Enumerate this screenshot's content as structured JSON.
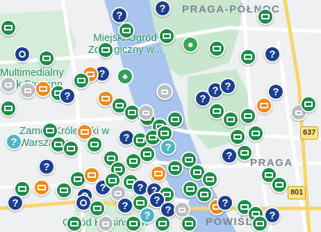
{
  "map": {
    "district_labels": [
      {
        "text": "PRAGA-PÓŁNOC",
        "id": "praga-polnoc"
      },
      {
        "text": "PRAGA",
        "id": "praga"
      },
      {
        "text": "POWIŚLE",
        "id": "powisle"
      }
    ],
    "place_labels": [
      {
        "text": "Miejski Ogród Zoologiczny w...",
        "id": "zoo"
      },
      {
        "text": "Multimedialny Park Fontann",
        "id": "fountain-park"
      },
      {
        "text": "Zamek Królewski w Warszawie",
        "id": "royal-castle"
      },
      {
        "text": "Ogród Krasińskich",
        "id": "garden"
      }
    ],
    "road_shields": [
      {
        "text": "637",
        "id": "road-637"
      },
      {
        "text": "801",
        "id": "road-801"
      }
    ],
    "colors": {
      "land": "#eef0f1",
      "river": "#a9c5ee",
      "park": "#c9e7cf",
      "ticket_marker": "#1e8c4a",
      "orange_marker": "#f08a1a",
      "question_marker": "#1c3f8f",
      "gray_marker": "#b9bec3"
    },
    "marker_icon_names": [
      "ticket-icon",
      "question-mark-icon",
      "clock-icon",
      "gift-icon",
      "paw-icon",
      "tree-icon",
      "ghost-icon",
      "mail-icon"
    ]
  }
}
